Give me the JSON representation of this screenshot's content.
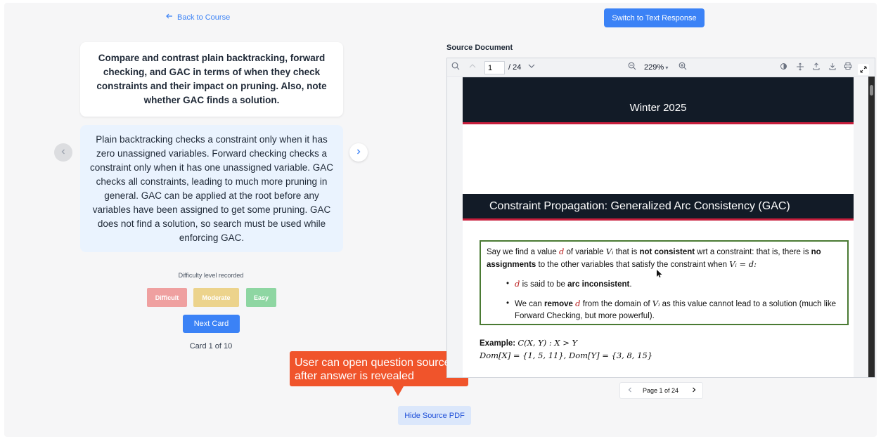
{
  "nav": {
    "back_label": "Back to Course",
    "switch_label": "Switch to Text Response"
  },
  "flashcard": {
    "question": "Compare and contrast plain backtracking, forward checking, and GAC in terms of when they check constraints and their impact on pruning. Also, note whether GAC finds a solution.",
    "answer": "Plain backtracking checks a constraint only when it has zero unassigned variables. Forward checking checks a constraint only when it has one unassigned variable. GAC checks all constraints, leading to much more pruning in general. GAC can be applied at the root before any variables have been assigned to get some pruning. GAC does not find a solution, so search must be used while enforcing GAC."
  },
  "difficulty": {
    "label": "Difficulty level recorded",
    "options": [
      "Difficult",
      "Moderate",
      "Easy"
    ]
  },
  "next_card_label": "Next Card",
  "card_counter": "Card 1 of 10",
  "callout": {
    "text": "User can open question source after answer is revealed"
  },
  "hide_pdf_label": "Hide Source PDF",
  "source": {
    "label": "Source Document",
    "page_input": "1",
    "page_total": "/ 24",
    "zoom": "229%",
    "pager_text": "Page 1 of 24"
  },
  "pdf": {
    "top_banner": "Winter 2025",
    "section_title": "Constraint Propagation: Generalized Arc Consistency (GAC)",
    "p1": "Say we find a value",
    "p2": "of variable",
    "p3": "that is",
    "p4": "not consistent",
    "p5": "wrt a constraint: that is, there is",
    "p6": "no assignments",
    "p7": "to the other variables that satisfy the constraint when",
    "b1a": "is said to be",
    "b1b": "arc inconsistent",
    "b2a": "We can",
    "b2b": "remove",
    "b2c": "from the domain of",
    "b2d": "as this value cannot lead to a solution (much like Forward Checking, but more powerful).",
    "example_label": "Example:",
    "example_expr": "C(X, Y) : X > Y",
    "example_dom": "Dom[X] = {1, 5, 11}, Dom[Y] = {3, 8, 15}",
    "var_d": "d",
    "var_vi": "Vᵢ",
    "eq": "Vᵢ = d:"
  },
  "colors": {
    "accent": "#3b82f6",
    "callout": "#f0542b",
    "banner": "#121b27",
    "banner_rule": "#c81e3c",
    "box_border": "#4a7a33"
  }
}
